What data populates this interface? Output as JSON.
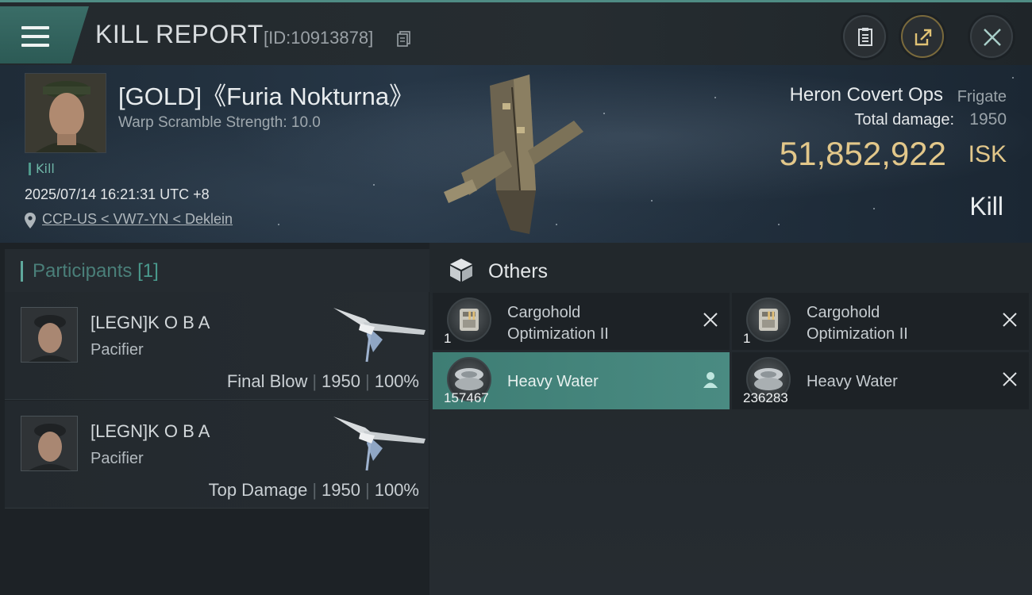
{
  "header": {
    "title": "KILL REPORT",
    "report_id": "[ID:10913878]"
  },
  "victim": {
    "name": "[GOLD]《Furia Nokturna》",
    "warp_scramble": "Warp Scramble Strength: 10.0",
    "kill_tag": "Kill",
    "datetime": "2025/07/14 16:21:31 UTC +8",
    "location": "CCP-US < VW7-YN < Deklein",
    "ship_type": "Heron Covert Ops",
    "ship_class": "Frigate",
    "total_damage_label": "Total damage:",
    "total_damage": "1950",
    "isk_value": "51,852,922",
    "isk_unit": "ISK",
    "result": "Kill"
  },
  "participants": {
    "title": "Participants",
    "count": "[1]",
    "rows": [
      {
        "name": "[LEGN]K O B A",
        "ship": "Pacifier",
        "role": "Final Blow",
        "damage": "1950",
        "percent": "100%"
      },
      {
        "name": "[LEGN]K O B A",
        "ship": "Pacifier",
        "role": "Top Damage",
        "damage": "1950",
        "percent": "100%"
      }
    ]
  },
  "others": {
    "title": "Others",
    "items": [
      {
        "name": "Cargohold Optimization II",
        "qty": "1",
        "meta": "II",
        "status": "destroyed"
      },
      {
        "name": "Cargohold Optimization II",
        "qty": "1",
        "meta": "II",
        "status": "destroyed"
      },
      {
        "name": "Heavy Water",
        "qty": "157467",
        "status": "dropped"
      },
      {
        "name": "Heavy Water",
        "qty": "236283",
        "status": "destroyed"
      }
    ]
  },
  "colors": {
    "accent": "#4f8c84",
    "isk": "#e2c78a",
    "selected_row": "#4a8b82"
  },
  "icons": {
    "menu": "hamburger-menu-icon",
    "copy": "copy-icon",
    "clipboard": "clipboard-icon",
    "share": "share-icon",
    "close": "close-icon",
    "location": "location-pin-icon",
    "others": "cube-box-icon",
    "destroyed": "x-mark-icon",
    "dropped": "person-icon"
  }
}
